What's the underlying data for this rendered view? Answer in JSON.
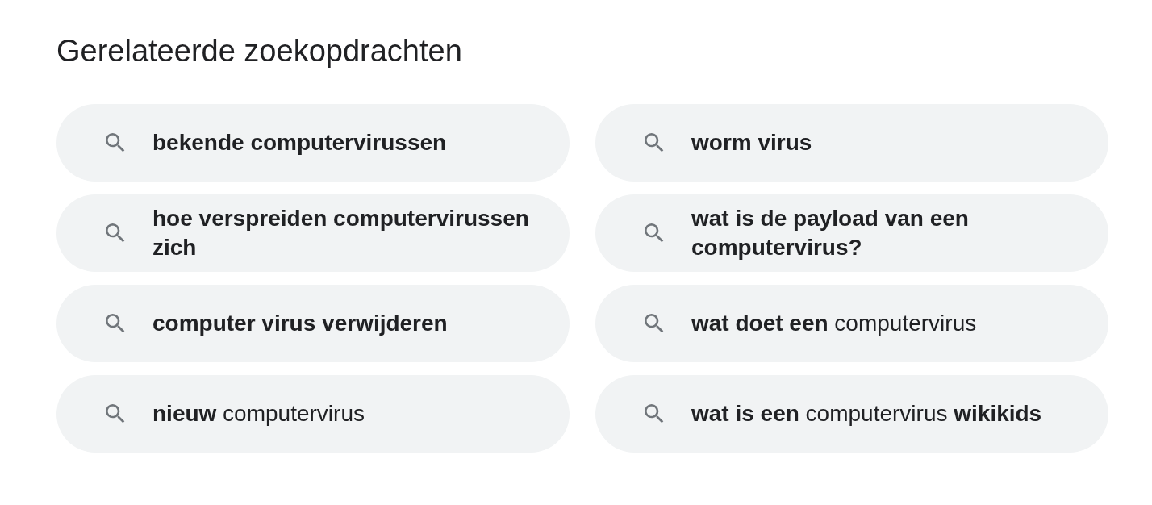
{
  "heading": "Gerelateerde zoekopdrachten",
  "suggestions": [
    {
      "text": "bekende computervirussen",
      "kind": "bold"
    },
    {
      "text": "worm virus",
      "kind": "bold"
    },
    {
      "text": "hoe verspreiden computervirussen zich",
      "kind": "bold"
    },
    {
      "text": "wat is de payload van een computervirus?",
      "kind": "bold"
    },
    {
      "text": "computer virus verwijderen",
      "kind": "bold"
    },
    {
      "text": "**wat doet een** computervirus",
      "kind": "mixed"
    },
    {
      "text": "**nieuw** computervirus",
      "kind": "mixed"
    },
    {
      "text": "**wat is een** computervirus **wikikids**",
      "kind": "mixed"
    }
  ]
}
